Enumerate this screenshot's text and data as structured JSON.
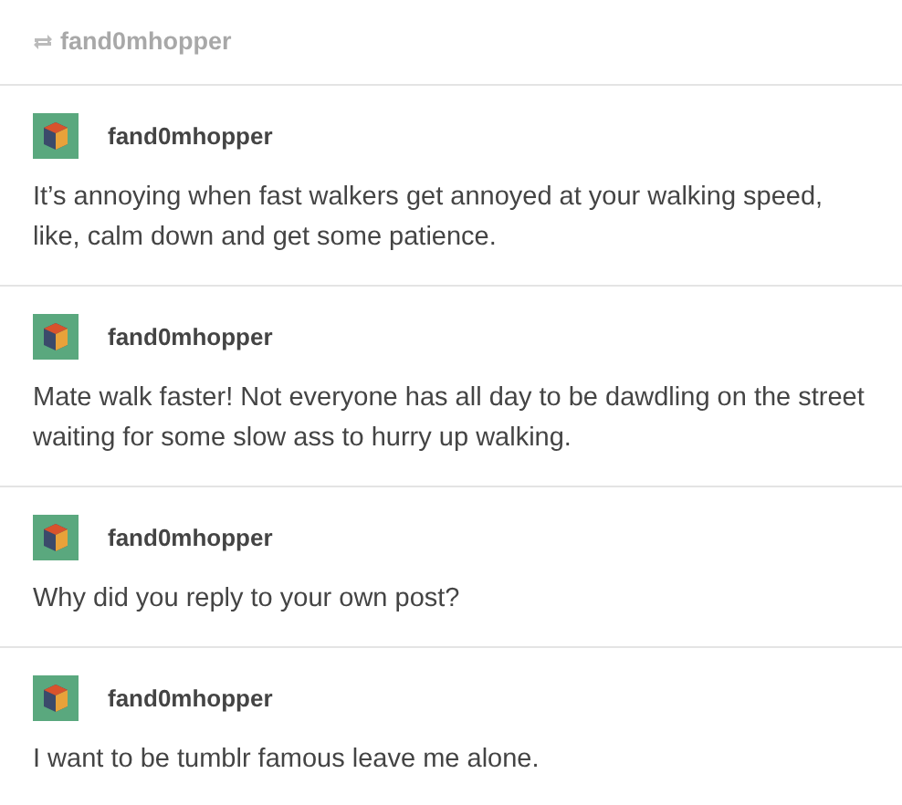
{
  "reblog_header": {
    "username": "fand0mhopper"
  },
  "posts": [
    {
      "username": "fand0mhopper",
      "text": "It’s annoying when fast walkers get annoyed at your walking speed, like, calm down and get some patience."
    },
    {
      "username": "fand0mhopper",
      "text": "Mate walk faster! Not everyone has all day to be dawdling on the street waiting for some slow ass to hurry up walking."
    },
    {
      "username": "fand0mhopper",
      "text": "Why did you reply to your own post?"
    },
    {
      "username": "fand0mhopper",
      "text": "I want to be tumblr famous leave me alone."
    }
  ]
}
